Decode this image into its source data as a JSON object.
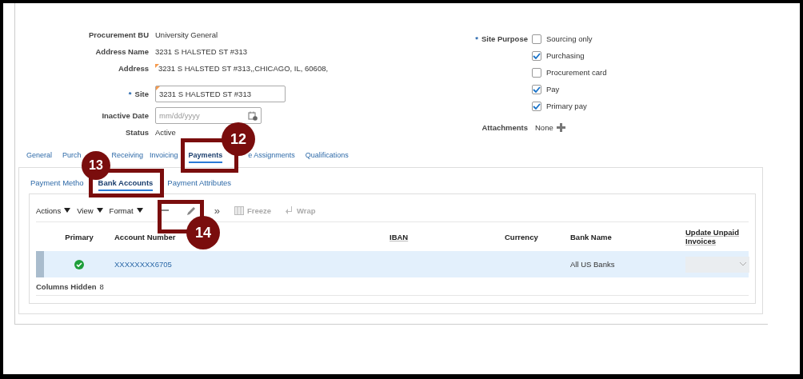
{
  "form_left": [
    {
      "label": "Procurement BU",
      "kind": "text",
      "value": "University General"
    },
    {
      "label": "Address Name",
      "kind": "text",
      "value": "3231 S HALSTED ST #313"
    },
    {
      "label": "Address",
      "kind": "flagged",
      "value": "3231 S HALSTED ST #313,,CHICAGO, IL, 60608,"
    },
    {
      "label": "Site",
      "kind": "input",
      "value": "3231 S HALSTED ST #313",
      "marker": "*"
    },
    {
      "label": "Inactive Date",
      "kind": "date",
      "placeholder": "mm/dd/yyyy"
    },
    {
      "label": "Status",
      "kind": "text",
      "value": "Active"
    }
  ],
  "site_purpose": {
    "label": "Site Purpose",
    "marker": "*",
    "options": [
      {
        "label": "Sourcing only",
        "checked": false
      },
      {
        "label": "Purchasing",
        "checked": true
      },
      {
        "label": "Procurement card",
        "checked": false
      },
      {
        "label": "Pay",
        "checked": true
      },
      {
        "label": "Primary pay",
        "checked": true
      }
    ]
  },
  "attachments": {
    "label": "Attachments",
    "value": "None"
  },
  "tabs": [
    {
      "label": "General",
      "selected": false
    },
    {
      "label": "Purch",
      "selected": false
    },
    {
      "label": "Receiving",
      "selected": false
    },
    {
      "label": "Invoicing",
      "selected": false
    },
    {
      "label": "Payments",
      "selected": true
    },
    {
      "label": "e Assignments",
      "selected": false
    },
    {
      "label": "Qualifications",
      "selected": false
    }
  ],
  "subtabs": [
    {
      "label": "Payment Metho",
      "selected": false
    },
    {
      "label": "Bank Accounts",
      "selected": true
    },
    {
      "label": "Payment Attributes",
      "selected": false
    }
  ],
  "toolbar": {
    "menus": [
      "Actions",
      "View",
      "Format"
    ],
    "more": "»",
    "buttons": [
      {
        "label": "Freeze",
        "disabled": true
      },
      {
        "label": "Wrap",
        "disabled": true
      }
    ]
  },
  "table": {
    "columns": [
      "Primary",
      "Account Number",
      "IBAN",
      "Currency",
      "Bank Name",
      "Update Unpaid Invoices"
    ],
    "rows": [
      {
        "primary": true,
        "account_number": "XXXXXXXX6705",
        "bank_name": "All US Banks",
        "selected": true
      }
    ],
    "columns_hidden": {
      "label": "Columns Hidden",
      "value": "8"
    }
  },
  "callouts": [
    "12",
    "13",
    "14"
  ]
}
